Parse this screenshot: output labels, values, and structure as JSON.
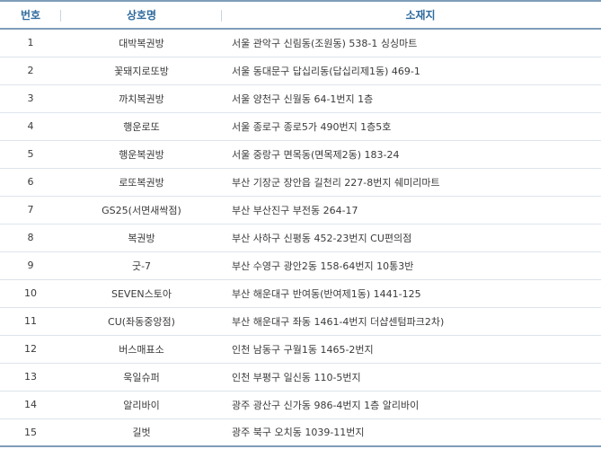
{
  "table": {
    "headers": {
      "number": "번호",
      "name": "상호명",
      "address": "소재지"
    },
    "rows": [
      {
        "no": "1",
        "name": "대박복권방",
        "address": "서울 관악구 신림동(조원동) 538-1 싱싱마트"
      },
      {
        "no": "2",
        "name": "꽃돼지로또방",
        "address": "서울 동대문구 답십리동(답십리제1동) 469-1"
      },
      {
        "no": "3",
        "name": "까치복권방",
        "address": "서울 양천구 신월동 64-1번지 1층"
      },
      {
        "no": "4",
        "name": "행운로또",
        "address": "서울 종로구 종로5가 490번지 1층5호"
      },
      {
        "no": "5",
        "name": "행운복권방",
        "address": "서울 중랑구 면목동(면목제2동) 183-24"
      },
      {
        "no": "6",
        "name": "로또복권방",
        "address": "부산 기장군 장안읍 길천리 227-8번지 쉐미리마트"
      },
      {
        "no": "7",
        "name": "GS25(서면새싹점)",
        "address": "부산 부산진구 부전동 264-17"
      },
      {
        "no": "8",
        "name": "복권방",
        "address": "부산 사하구 신평동 452-23번지 CU편의점"
      },
      {
        "no": "9",
        "name": "굿-7",
        "address": "부산 수영구 광안2동 158-64번지 10통3반"
      },
      {
        "no": "10",
        "name": "SEVEN스토아",
        "address": "부산 해운대구 반여동(반여제1동) 1441-125"
      },
      {
        "no": "11",
        "name": "CU(좌동중앙점)",
        "address": "부산 해운대구 좌동 1461-4번지 더샵센텀파크2차)"
      },
      {
        "no": "12",
        "name": "버스매표소",
        "address": "인천 남동구 구월1동 1465-2번지"
      },
      {
        "no": "13",
        "name": "욱일슈퍼",
        "address": "인천 부평구 일신동 110-5번지"
      },
      {
        "no": "14",
        "name": "알리바이",
        "address": "광주 광산구 신가동 986-4번지 1층 알리바이"
      },
      {
        "no": "15",
        "name": "길벗",
        "address": "광주 북구 오치동 1039-11번지"
      }
    ]
  },
  "colors": {
    "header_text": "#2f6b9e",
    "border_strong": "#7f9db9",
    "border_row": "#dde4ec"
  }
}
